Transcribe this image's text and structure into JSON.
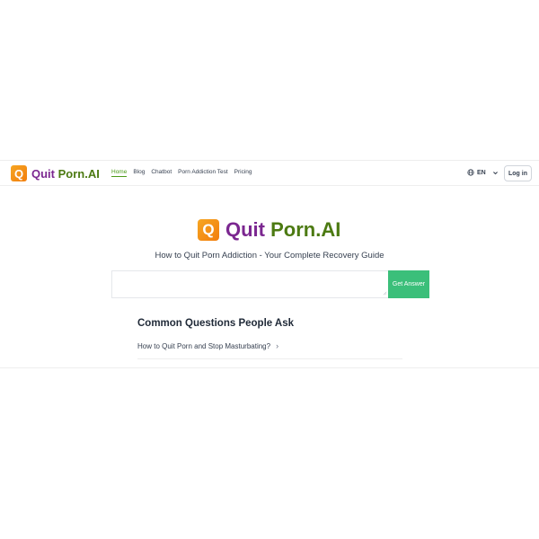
{
  "header": {
    "logo": {
      "mark": "Q",
      "text_part1": "Quit",
      "text_part2": "Porn.AI"
    },
    "nav": [
      {
        "label": "Home",
        "active": true
      },
      {
        "label": "Blog"
      },
      {
        "label": "Chatbot"
      },
      {
        "label": "Porn Addiction Test"
      },
      {
        "label": "Pricing"
      }
    ],
    "language": {
      "label": "EN",
      "icon": "globe-icon"
    },
    "login_label": "Log in"
  },
  "hero": {
    "logo": {
      "mark": "Q",
      "text_part1": "Quit",
      "text_part2": "Porn.AI"
    },
    "subtitle": "How to Quit Porn Addiction - Your Complete Recovery Guide",
    "search": {
      "value": "",
      "placeholder": ""
    },
    "button_label": "Get Answer"
  },
  "faq": {
    "title": "Common Questions People Ask",
    "items": [
      {
        "question": "How to Quit Porn and Stop Masturbating?"
      }
    ]
  },
  "colors": {
    "brand_purple": "#7b2790",
    "brand_green": "#4c7a12",
    "accent_orange": "#f27d0c",
    "button_green": "#3bbf7a"
  }
}
